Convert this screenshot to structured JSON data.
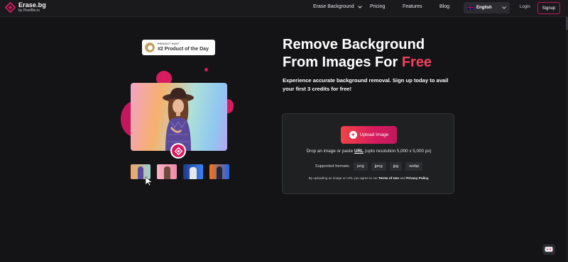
{
  "brand": {
    "name": "Erase.bg",
    "sub": "by PixelBin.io"
  },
  "nav": {
    "links": [
      {
        "label": "Erase Background",
        "dropdown": true
      },
      {
        "label": "Pricing"
      },
      {
        "label": "Features"
      },
      {
        "label": "Blog"
      }
    ],
    "language": "English",
    "login": "Login",
    "signup": "Signup"
  },
  "badge": {
    "small": "PRODUCT HUNT",
    "big": "#2 Product of the Day"
  },
  "hero": {
    "title_line1": "Remove Background",
    "title_line2_pre": "From Images For ",
    "title_line2_accent": "Free",
    "subtitle": "Experience accurate background removal. Sign up today to avail your first 3 credits for free!"
  },
  "upload": {
    "button": "Upload Image",
    "drop_pre": "Drop an image or paste ",
    "drop_link": "URL",
    "drop_post": " (upto resolution 5,000 x 5,000 px)",
    "formats_label": "Supported formats:",
    "formats": [
      "png",
      "jpeg",
      "jpg",
      "webp"
    ],
    "terms_pre": "By uploading an image or URL you agree to our ",
    "terms_link1": "Terms of Use",
    "terms_mid": " and ",
    "terms_link2": "Privacy Policy."
  },
  "colors": {
    "accent": "#d81b60",
    "free": "#f43f5e",
    "background": "#141416"
  }
}
